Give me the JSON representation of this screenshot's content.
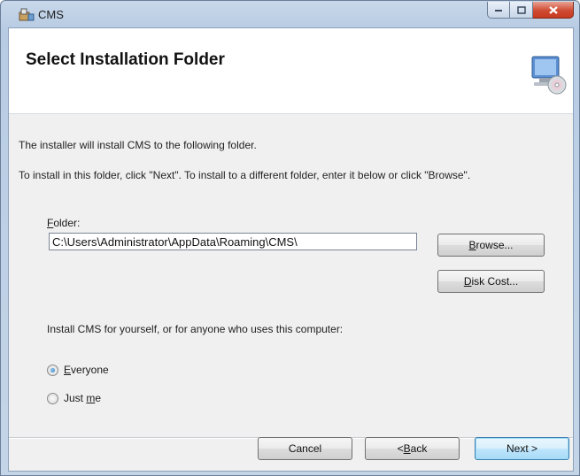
{
  "window": {
    "title": "CMS",
    "buttons": {
      "minimize": "minimize",
      "maximize": "maximize",
      "close": "close"
    }
  },
  "header": {
    "title": "Select Installation Folder"
  },
  "body": {
    "line1": "The installer will install CMS to the following folder.",
    "line2": "To install in this folder, click \"Next\". To install to a different folder, enter it below or click \"Browse\"."
  },
  "folder": {
    "label_accel": "F",
    "label_rest": "older:",
    "value": "C:\\Users\\Administrator\\AppData\\Roaming\\CMS\\"
  },
  "buttons": {
    "browse_accel": "B",
    "browse_rest": "rowse...",
    "disk_cost_accel": "D",
    "disk_cost_rest": "isk Cost...",
    "cancel": "Cancel",
    "back_pre": "< ",
    "back_accel": "B",
    "back_rest": "ack",
    "next": "Next >"
  },
  "install_for": {
    "prompt": "Install CMS for yourself, or for anyone who uses this computer:",
    "options": [
      {
        "accel": "E",
        "rest": "veryone",
        "checked": true
      },
      {
        "pre": "Just ",
        "accel": "m",
        "rest": "e",
        "checked": false
      }
    ]
  },
  "icons": [
    "installer-app-icon",
    "computer-cd-icon"
  ],
  "colors": {
    "close_button": "#cf4b33",
    "header_bg": "#ffffff",
    "dialog_bg": "#f0f0f0"
  }
}
